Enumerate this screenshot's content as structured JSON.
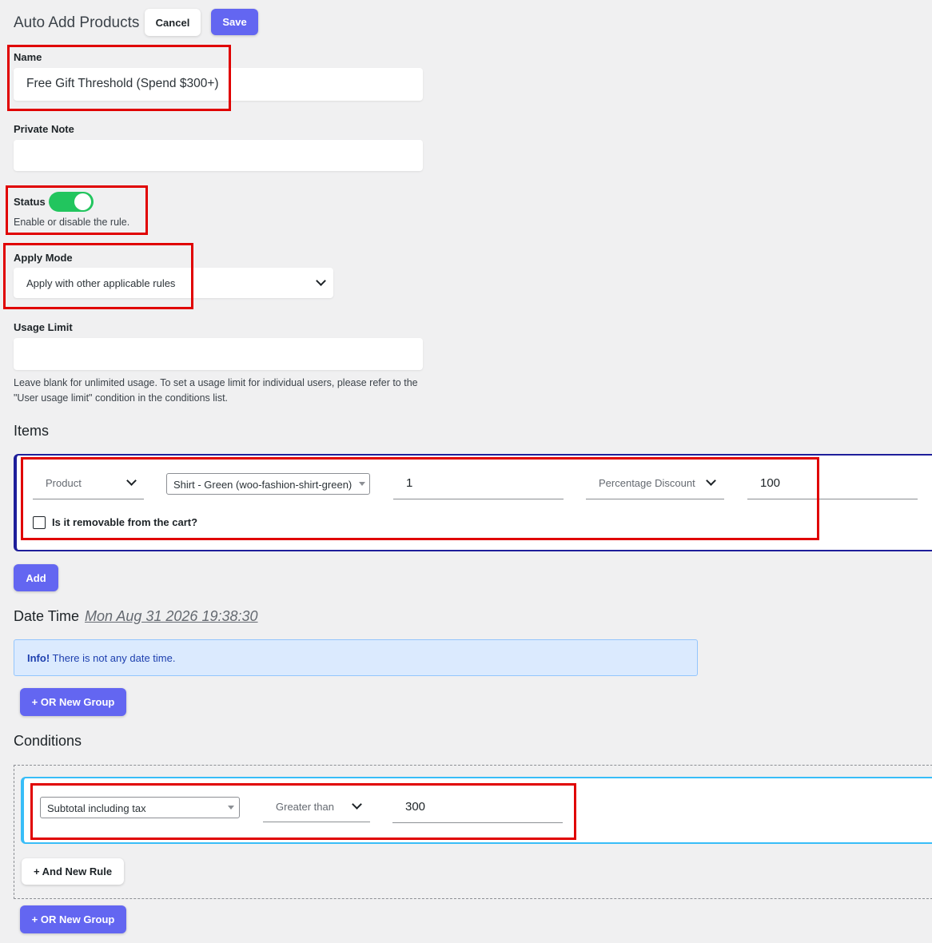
{
  "header": {
    "title": "Auto Add Products",
    "cancel_label": "Cancel",
    "save_label": "Save"
  },
  "form": {
    "name_label": "Name",
    "name_value": "Free Gift Threshold (Spend $300+)",
    "private_note_label": "Private Note",
    "private_note_value": "",
    "status_label": "Status",
    "status_enabled": true,
    "status_help": "Enable or disable the rule.",
    "apply_mode_label": "Apply Mode",
    "apply_mode_value": "Apply with other applicable rules",
    "usage_limit_label": "Usage Limit",
    "usage_limit_value": "",
    "usage_limit_help": "Leave blank for unlimited usage. To set a usage limit for individual users, please refer to the \"User usage limit\" condition in the conditions list."
  },
  "items": {
    "title": "Items",
    "row": {
      "type": "Product",
      "product": "Shirt - Green (woo-fashion-shirt-green)",
      "quantity": "1",
      "discount_type": "Percentage Discount",
      "discount_value": "100",
      "removable_label": "Is it removable from the cart?",
      "removable_checked": false
    },
    "add_label": "Add"
  },
  "date_time": {
    "title": "Date Time",
    "current": "Mon Aug 31 2026 19:38:30",
    "info_strong": "Info!",
    "info_text": "There is not any date time.",
    "or_group_label": "+ OR New Group"
  },
  "conditions": {
    "title": "Conditions",
    "rule": {
      "field": "Subtotal including tax",
      "operator": "Greater than",
      "value": "300"
    },
    "and_rule_label": "+ And New Rule",
    "or_group_label": "+ OR New Group"
  },
  "colors": {
    "accent": "#6366f1",
    "toggle_on": "#22c55e",
    "highlight": "#e00000",
    "items_border": "#1e1e9a",
    "conditions_border": "#38bdf8",
    "info_bg": "#dbeafe"
  }
}
